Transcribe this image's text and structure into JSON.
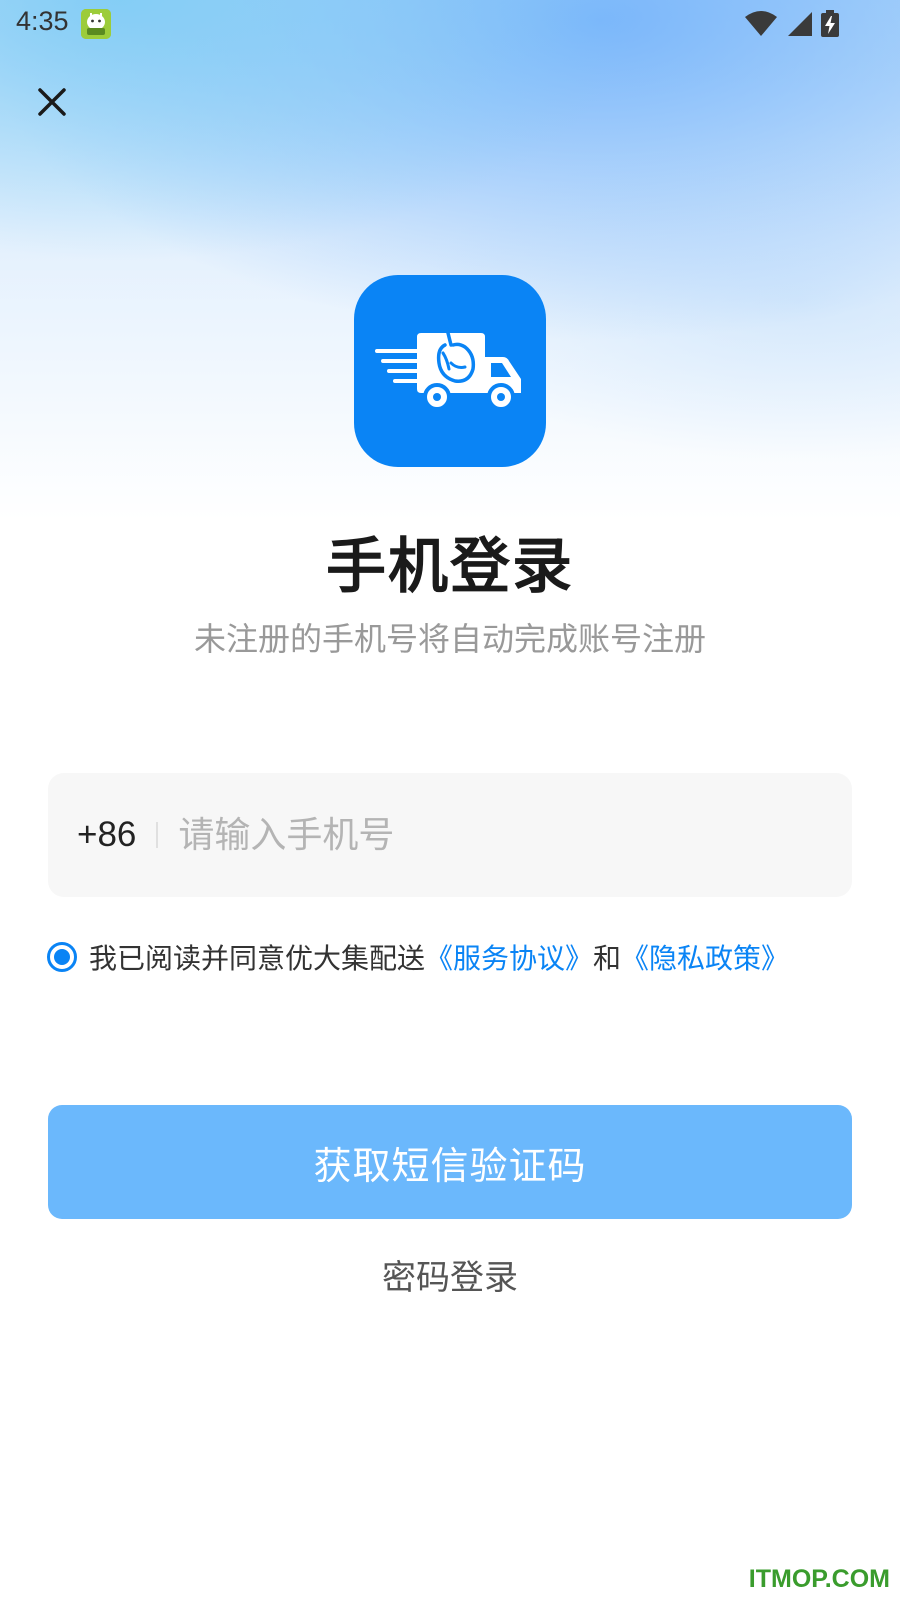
{
  "status_bar": {
    "time": "4:35",
    "app_icon": "android-mascot-icon",
    "wifi_icon": "wifi-icon",
    "signal_icon": "signal-icon",
    "battery_icon": "battery-charging-icon"
  },
  "header": {
    "close_icon": "close-icon"
  },
  "logo": {
    "icon": "delivery-truck-icon",
    "bg_color": "#0a84f5"
  },
  "login": {
    "title": "手机登录",
    "subtitle": "未注册的手机号将自动完成账号注册",
    "country_code": "+86",
    "phone_placeholder": "请输入手机号",
    "phone_value": "",
    "agreement": {
      "checked": true,
      "prefix": "我已阅读并同意优大集配送",
      "service_link": "《服务协议》",
      "and": "和",
      "privacy_link": "《隐私政策》"
    },
    "sms_button": "获取短信验证码",
    "password_login": "密码登录"
  },
  "colors": {
    "accent": "#0a84f5",
    "button_disabled": "#6bb8fc",
    "watermark": "#3a9c2d"
  },
  "watermark": "ITMOP.COM"
}
